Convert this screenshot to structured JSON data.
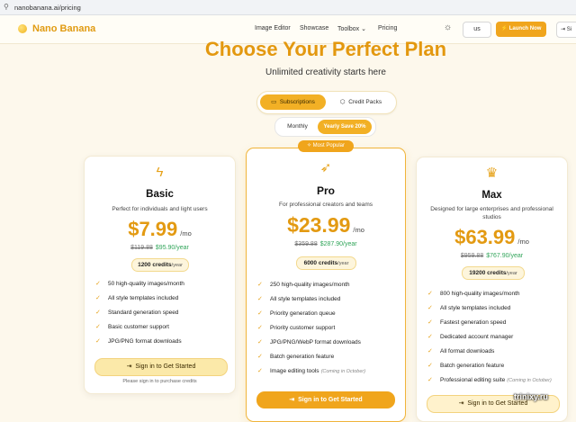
{
  "browser": {
    "url": "nanobanana.ai/pricing"
  },
  "nav": {
    "brand": "Nano Banana",
    "links": [
      "Image Editor",
      "Showcase",
      "Toolbox",
      "Pricing"
    ],
    "lang": "us",
    "launch": "Launch Now",
    "signin": "Si"
  },
  "hero": {
    "title": "Choose Your Perfect Plan",
    "subtitle": "Unlimited creativity starts here"
  },
  "tabs": {
    "subscriptions": "Subscriptions",
    "credit_packs": "Credit Packs"
  },
  "billing": {
    "monthly": "Monthly",
    "yearly": "Yearly Save 20%"
  },
  "plans": [
    {
      "name": "Basic",
      "desc": "Perfect for individuals and light users",
      "price": "$7.99",
      "per": "/mo",
      "old": "$119.88",
      "yearly": "$95.90/year",
      "credits": "1200 credits",
      "credits_unit": "/year",
      "features": [
        "50 high-quality images/month",
        "All style templates included",
        "Standard generation speed",
        "Basic customer support",
        "JPG/PNG format downloads"
      ],
      "cta": "Sign in to Get Started",
      "note": "Please sign in to purchase credits"
    },
    {
      "badge": "Most Popular",
      "name": "Pro",
      "desc": "For professional creators and teams",
      "price": "$23.99",
      "per": "/mo",
      "old": "$359.88",
      "yearly": "$287.90/year",
      "credits": "6000 credits",
      "credits_unit": "/year",
      "features": [
        "250 high-quality images/month",
        "All style templates included",
        "Priority generation queue",
        "Priority customer support",
        "JPG/PNG/WebP format downloads",
        "Batch generation feature",
        "Image editing tools"
      ],
      "feature_note": "(Coming in October)",
      "cta": "Sign in to Get Started"
    },
    {
      "name": "Max",
      "desc": "Designed for large enterprises and professional studios",
      "price": "$63.99",
      "per": "/mo",
      "old": "$959.88",
      "yearly": "$767.90/year",
      "credits": "19200 credits",
      "credits_unit": "/year",
      "features": [
        "800 high-quality images/month",
        "All style templates included",
        "Fastest generation speed",
        "Dedicated account manager",
        "All format downloads",
        "Batch generation feature",
        "Professional editing suite"
      ],
      "feature_note": "(Coming in October)",
      "cta": "Sign in to Get Started"
    }
  ],
  "watermark": "trinixy.ru"
}
